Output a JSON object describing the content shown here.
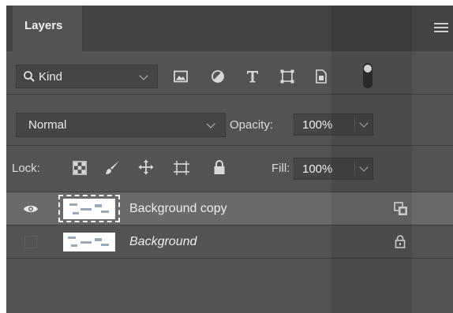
{
  "panel": {
    "tab_label": "Layers",
    "menu_icon": "hamburger-menu-icon"
  },
  "filter": {
    "kind_label": "Kind",
    "icons": [
      "image-filter-icon",
      "adjustment-filter-icon",
      "type-filter-icon",
      "shape-filter-icon",
      "smart-object-filter-icon",
      "filter-toggle-icon"
    ]
  },
  "blend": {
    "mode": "Normal",
    "opacity_label": "Opacity:",
    "opacity_value": "100%"
  },
  "lock": {
    "label": "Lock:",
    "icons": [
      "lock-transparent-pixels-icon",
      "lock-image-pixels-icon",
      "lock-position-icon",
      "lock-artboard-icon",
      "lock-all-icon"
    ],
    "fill_label": "Fill:",
    "fill_value": "100%"
  },
  "layers": [
    {
      "name": "Background copy",
      "visible": true,
      "selected": true,
      "badge_icon": "smart-object-badge-icon"
    },
    {
      "name": "Background",
      "visible": false,
      "selected": false,
      "badge_icon": "lock-icon"
    }
  ],
  "colors": {
    "panel_bg": "#535353",
    "header_bg": "#434343",
    "selected_row": "#6a6a6a",
    "field_bg": "#454545"
  }
}
